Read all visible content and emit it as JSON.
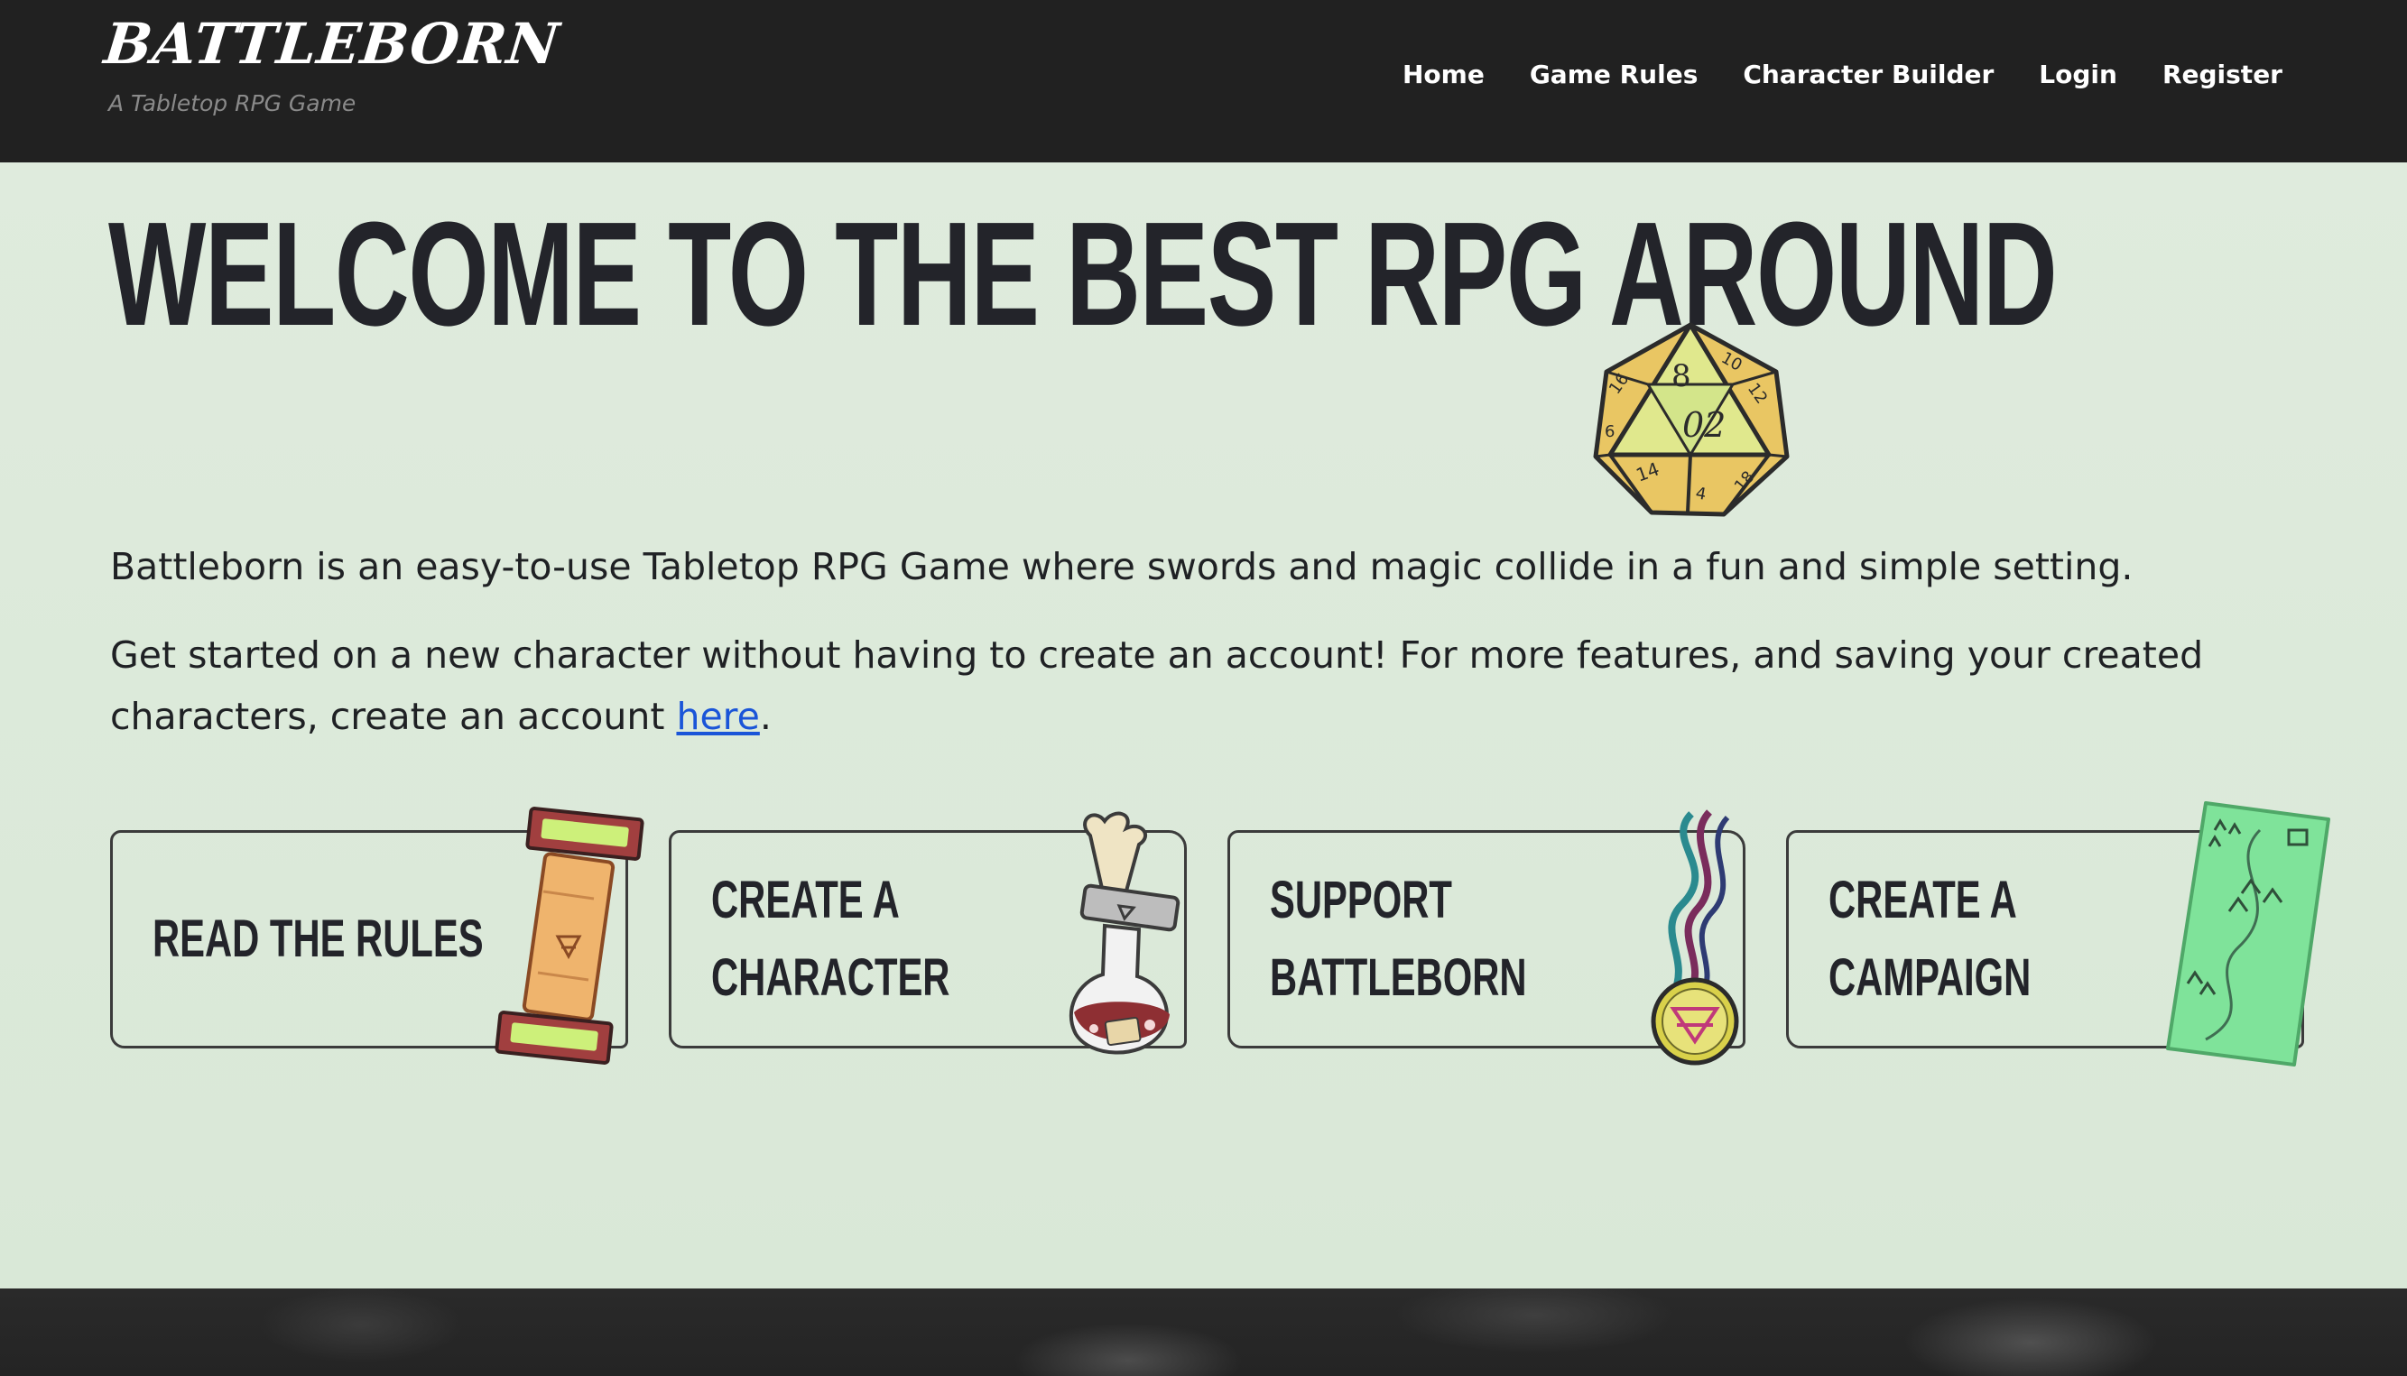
{
  "header": {
    "brand_title": "BATTLEBORN",
    "brand_tagline": "A Tabletop RPG Game",
    "nav": [
      {
        "label": "Home"
      },
      {
        "label": "Game Rules"
      },
      {
        "label": "Character Builder"
      },
      {
        "label": "Login"
      },
      {
        "label": "Register"
      }
    ]
  },
  "hero": {
    "heading": "WELCOME TO THE BEST RPG AROUND",
    "d20_icon": "d20-die-icon",
    "paragraph1": "Battleborn is an easy-to-use Tabletop RPG Game where swords and magic collide in a fun and simple setting.",
    "paragraph2_before": "Get started on a new character without having to create an account! For more features, and saving your created characters, create an account ",
    "paragraph2_link": "here",
    "paragraph2_after": "."
  },
  "cards": [
    {
      "label": "READ THE RULES",
      "icon": "scroll-icon"
    },
    {
      "label": "CREATE A\nCHARACTER",
      "icon": "potion-icon"
    },
    {
      "label": "SUPPORT\nBATTLEBORN",
      "icon": "medal-icon"
    },
    {
      "label": "CREATE A CAMPAIGN",
      "icon": "map-icon"
    }
  ],
  "colors": {
    "header_bg": "#212121",
    "hero_bg": "#dce9db",
    "link": "#1a55d8",
    "text": "#222222"
  }
}
